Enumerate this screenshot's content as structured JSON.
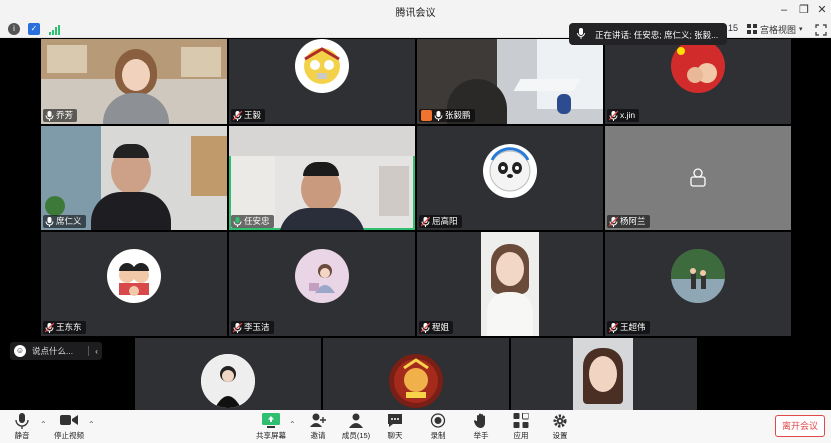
{
  "window": {
    "title": "腾讯会议"
  },
  "topbar": {
    "grid_view_label": "宫格视图",
    "page_number": "15",
    "speaker_banner": "正在讲话: 任安忠; 席仁义; 张毅..."
  },
  "participants": [
    {
      "name": "乔芳"
    },
    {
      "name": "王毅"
    },
    {
      "name": "张毅鹏"
    },
    {
      "name": "x.jin"
    },
    {
      "name": "席仁义"
    },
    {
      "name": "任安忠"
    },
    {
      "name": "屈高阳"
    },
    {
      "name": "杨阿兰"
    },
    {
      "name": "王东东"
    },
    {
      "name": "李玉洁"
    },
    {
      "name": "程姐"
    },
    {
      "name": "王超伟"
    }
  ],
  "chat": {
    "placeholder": "说点什么..."
  },
  "toolbar": {
    "mute": "静音",
    "stop_video": "停止视频",
    "share_screen": "共享屏幕",
    "invite": "邀请",
    "members": "成员(15)",
    "chat": "聊天",
    "record": "录制",
    "raise_hand": "举手",
    "apps": "应用",
    "settings": "设置",
    "leave": "离开会议"
  },
  "colors": {
    "accent_green": "#2fbf71",
    "leave_red": "#e04848",
    "tile_bg": "#2f3034"
  }
}
